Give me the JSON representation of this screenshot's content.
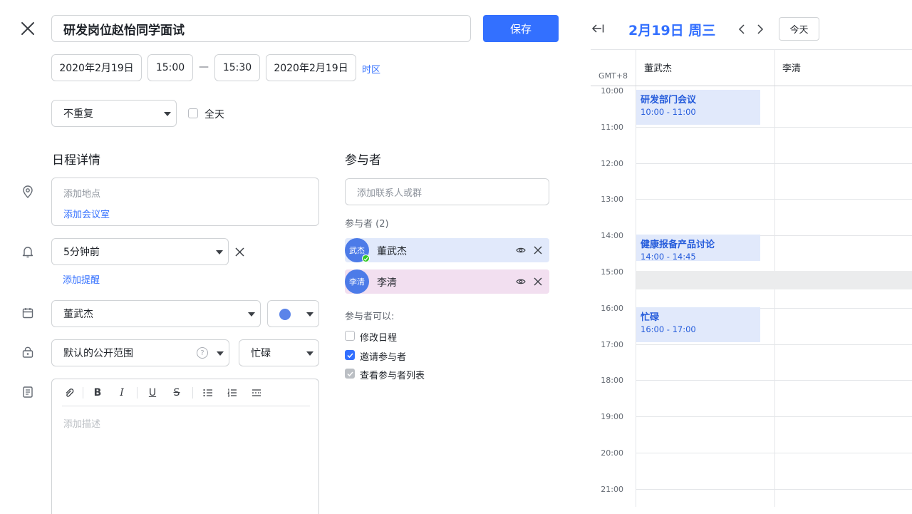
{
  "editor": {
    "title_value": "研发岗位赵怡同学面试",
    "save_label": "保存",
    "start_date": "2020年2月19日",
    "start_time": "15:00",
    "range_sep": "—",
    "end_time": "15:30",
    "end_date": "2020年2月19日",
    "timezone_link": "时区",
    "repeat_value": "不重复",
    "allday_label": "全天",
    "details_heading": "日程详情",
    "location_placeholder": "添加地点",
    "add_room_link": "添加会议室",
    "reminder_value": "5分钟前",
    "add_reminder_link": "添加提醒",
    "calendar_owner": "董武杰",
    "visibility_value": "默认的公开范围",
    "help_glyph": "?",
    "busy_value": "忙碌",
    "description_placeholder": "添加描述",
    "colors": {
      "primary": "#3370ff",
      "event_bg": "#e1e9fb",
      "color_dot": "#5b84e9"
    }
  },
  "attendees": {
    "heading": "参与者",
    "search_placeholder": "添加联系人或群",
    "count_label": "参与者 (2)",
    "list": [
      {
        "avatar_text": "武杰",
        "name": "董武杰",
        "bg": "#e1e9fb"
      },
      {
        "avatar_text": "李清",
        "name": "李清",
        "bg": "#f2dff0"
      }
    ],
    "permissions_heading": "参与者可以:",
    "permissions": [
      {
        "label": "修改日程",
        "checked": false
      },
      {
        "label": "邀请参与者",
        "checked": true
      },
      {
        "label": "查看参与者列表",
        "checked": true
      }
    ]
  },
  "calendar": {
    "date_title": "2月19日 周三",
    "today_label": "今天",
    "timezone": "GMT+8",
    "columns": [
      "董武杰",
      "李清"
    ],
    "hours": [
      "10:00",
      "11:00",
      "12:00",
      "13:00",
      "14:00",
      "15:00",
      "16:00",
      "17:00",
      "18:00",
      "19:00",
      "20:00",
      "21:00"
    ],
    "events": [
      {
        "title": "研发部门会议",
        "time": "10:00 - 11:00"
      },
      {
        "title": "健康报备产品讨论",
        "time": "14:00 - 14:45"
      },
      {
        "title": "忙碌",
        "time": "16:00 - 17:00"
      }
    ]
  }
}
